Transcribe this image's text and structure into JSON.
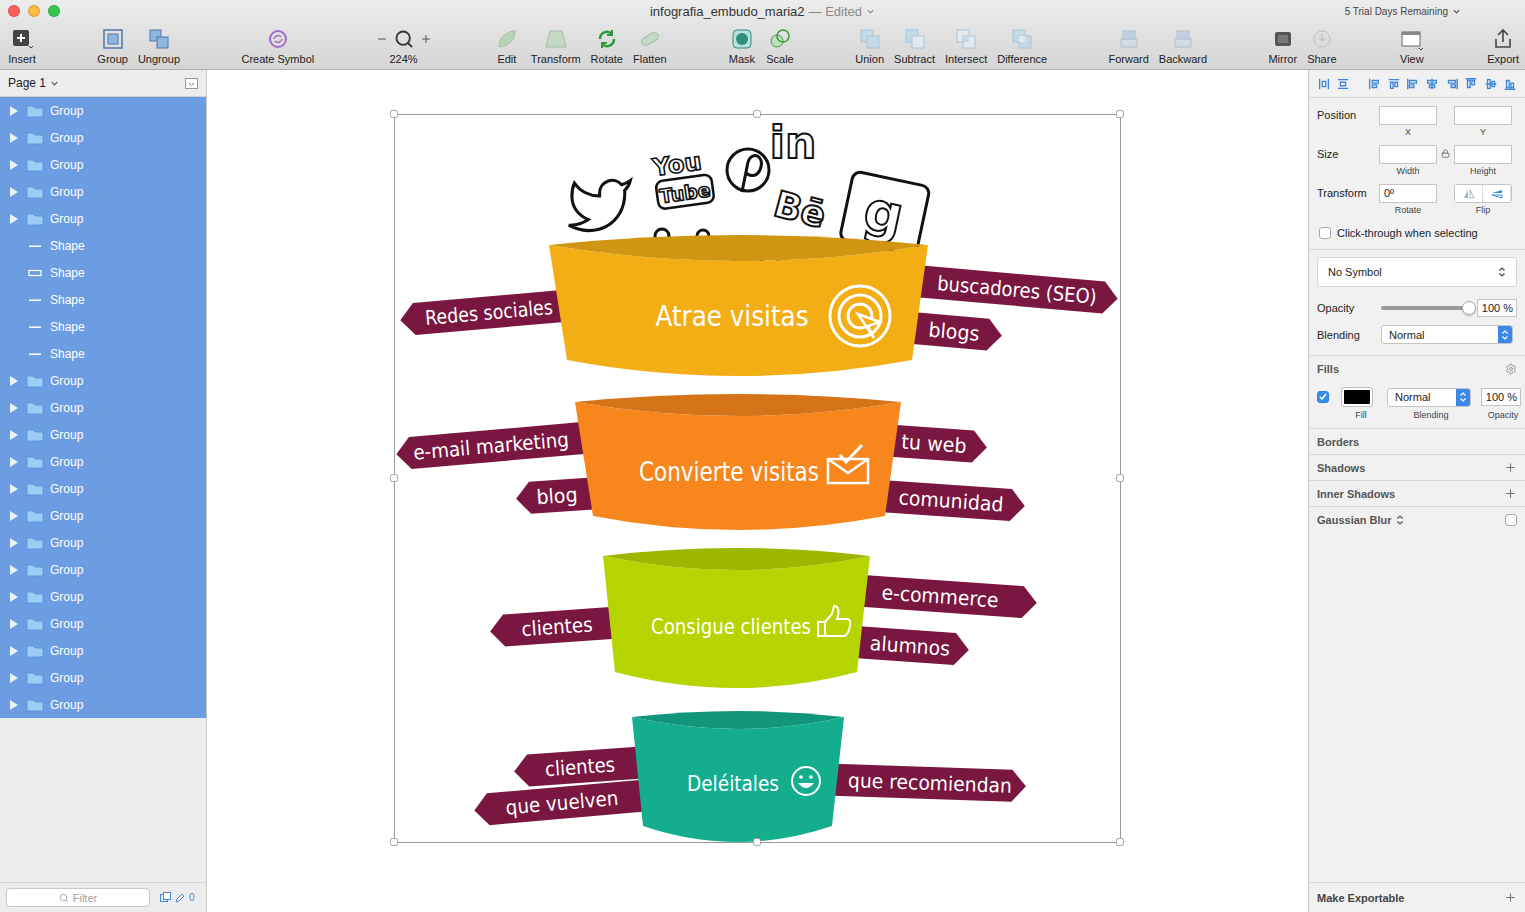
{
  "window": {
    "title": "infografia_embudo_maria2",
    "status": "— Edited",
    "trial": "5 Trial Days Remaining"
  },
  "toolbar": {
    "groups": [
      [
        {
          "label": "Insert",
          "kind": "button",
          "disabled": false
        }
      ],
      [
        {
          "label": "Group",
          "kind": "button",
          "disabled": false
        },
        {
          "label": "Ungroup",
          "kind": "button",
          "disabled": false
        }
      ],
      [
        {
          "label": "Create Symbol",
          "kind": "button",
          "disabled": false
        }
      ],
      [
        {
          "label": "224%",
          "kind": "zoom",
          "disabled": false
        }
      ],
      [
        {
          "label": "Edit",
          "kind": "button",
          "disabled": true
        },
        {
          "label": "Transform",
          "kind": "button",
          "disabled": true
        },
        {
          "label": "Rotate",
          "kind": "button",
          "disabled": false
        },
        {
          "label": "Flatten",
          "kind": "button",
          "disabled": true
        }
      ],
      [
        {
          "label": "Mask",
          "kind": "button",
          "disabled": false
        },
        {
          "label": "Scale",
          "kind": "button",
          "disabled": false
        }
      ],
      [
        {
          "label": "Union",
          "kind": "button",
          "disabled": true
        },
        {
          "label": "Subtract",
          "kind": "button",
          "disabled": true
        },
        {
          "label": "Intersect",
          "kind": "button",
          "disabled": true
        },
        {
          "label": "Difference",
          "kind": "button",
          "disabled": true
        }
      ],
      [
        {
          "label": "Forward",
          "kind": "button",
          "disabled": true
        },
        {
          "label": "Backward",
          "kind": "button",
          "disabled": true
        }
      ],
      [
        {
          "label": "Mirror",
          "kind": "button",
          "disabled": false
        },
        {
          "label": "Share",
          "kind": "button",
          "disabled": true
        }
      ],
      [
        {
          "label": "View",
          "kind": "button",
          "disabled": false
        }
      ],
      [
        {
          "label": "Export",
          "kind": "button",
          "disabled": false
        }
      ]
    ]
  },
  "layers": {
    "page": "Page 1",
    "filter_placeholder": "Filter",
    "count": "0",
    "items": [
      {
        "name": "Group",
        "kind": "group",
        "selected": true,
        "expanded": false
      },
      {
        "name": "Group",
        "kind": "group",
        "selected": true,
        "expanded": false
      },
      {
        "name": "Group",
        "kind": "group",
        "selected": true,
        "expanded": false
      },
      {
        "name": "Group",
        "kind": "group",
        "selected": true,
        "expanded": false
      },
      {
        "name": "Group",
        "kind": "group",
        "selected": true,
        "expanded": false
      },
      {
        "name": "Shape",
        "kind": "line",
        "selected": true,
        "expanded": false
      },
      {
        "name": "Shape",
        "kind": "rectangle",
        "selected": true,
        "expanded": false
      },
      {
        "name": "Shape",
        "kind": "line",
        "selected": true,
        "expanded": false
      },
      {
        "name": "Shape",
        "kind": "line",
        "selected": true,
        "expanded": false
      },
      {
        "name": "Shape",
        "kind": "line",
        "selected": true,
        "expanded": false
      },
      {
        "name": "Group",
        "kind": "group",
        "selected": true,
        "expanded": false
      },
      {
        "name": "Group",
        "kind": "group",
        "selected": true,
        "expanded": false
      },
      {
        "name": "Group",
        "kind": "group",
        "selected": true,
        "expanded": false
      },
      {
        "name": "Group",
        "kind": "group",
        "selected": true,
        "expanded": false
      },
      {
        "name": "Group",
        "kind": "group",
        "selected": true,
        "expanded": false
      },
      {
        "name": "Group",
        "kind": "group",
        "selected": true,
        "expanded": false
      },
      {
        "name": "Group",
        "kind": "group",
        "selected": true,
        "expanded": false
      },
      {
        "name": "Group",
        "kind": "group",
        "selected": true,
        "expanded": false
      },
      {
        "name": "Group",
        "kind": "group",
        "selected": true,
        "expanded": false
      },
      {
        "name": "Group",
        "kind": "group",
        "selected": true,
        "expanded": false
      },
      {
        "name": "Group",
        "kind": "group",
        "selected": true,
        "expanded": false
      },
      {
        "name": "Group",
        "kind": "group",
        "selected": true,
        "expanded": false
      },
      {
        "name": "Group",
        "kind": "group",
        "selected": true,
        "expanded": false
      }
    ]
  },
  "infographic": {
    "logo_texts": {
      "youtube_top": "You",
      "youtube_bottom": "Tube",
      "linkedin": "in",
      "behance": "Bē",
      "google": "g"
    },
    "stages": [
      {
        "title": "Atrae visitas",
        "color": "#f2ae14",
        "left": [
          "Redes sociales"
        ],
        "right": [
          "buscadores (SEO)",
          "blogs"
        ]
      },
      {
        "title": "Convierte visitas",
        "color": "#f7861c",
        "left": [
          "e-mail marketing",
          "blog"
        ],
        "right": [
          "tu web",
          "comunidad"
        ]
      },
      {
        "title": "Consigue clientes",
        "color": "#b6d400",
        "left": [
          "clientes"
        ],
        "right": [
          "e-commerce",
          "alumnos"
        ]
      },
      {
        "title": "Deléitales",
        "color": "#14ae8f",
        "left": [
          "clientes",
          "que vuelven"
        ],
        "right": [
          "que recomiendan"
        ]
      }
    ]
  },
  "inspector": {
    "position": {
      "label": "Position",
      "fields": [
        {
          "label": "X",
          "value": ""
        },
        {
          "label": "Y",
          "value": ""
        }
      ]
    },
    "size": {
      "label": "Size",
      "fields": [
        {
          "label": "Width",
          "value": ""
        },
        {
          "label": "Height",
          "value": ""
        }
      ]
    },
    "transform": {
      "label": "Transform",
      "rotate": {
        "label": "Rotate",
        "value": "0º"
      },
      "flip": {
        "label": "Flip"
      }
    },
    "click_through": {
      "label": "Click-through when selecting",
      "checked": false
    },
    "symbol": "No Symbol",
    "opacity": {
      "label": "Opacity",
      "level": 1,
      "reading": "100 %"
    },
    "blending": {
      "label": "Blending",
      "value": "Normal"
    },
    "fills": {
      "title": "Fills",
      "sublabels": [
        "Fill",
        "Blending",
        "Opacity"
      ],
      "items": [
        {
          "enabled": true,
          "color": "#000000",
          "blending": "Normal",
          "opacity": "100 %"
        }
      ]
    },
    "sections": [
      {
        "title": "Borders",
        "kind": "plain",
        "checked": false
      },
      {
        "title": "Shadows",
        "kind": "add",
        "checked": false
      },
      {
        "title": "Inner Shadows",
        "kind": "add",
        "checked": false
      },
      {
        "title": "Gaussian Blur",
        "kind": "toggle",
        "checked": false
      }
    ],
    "export": "Make Exportable"
  }
}
